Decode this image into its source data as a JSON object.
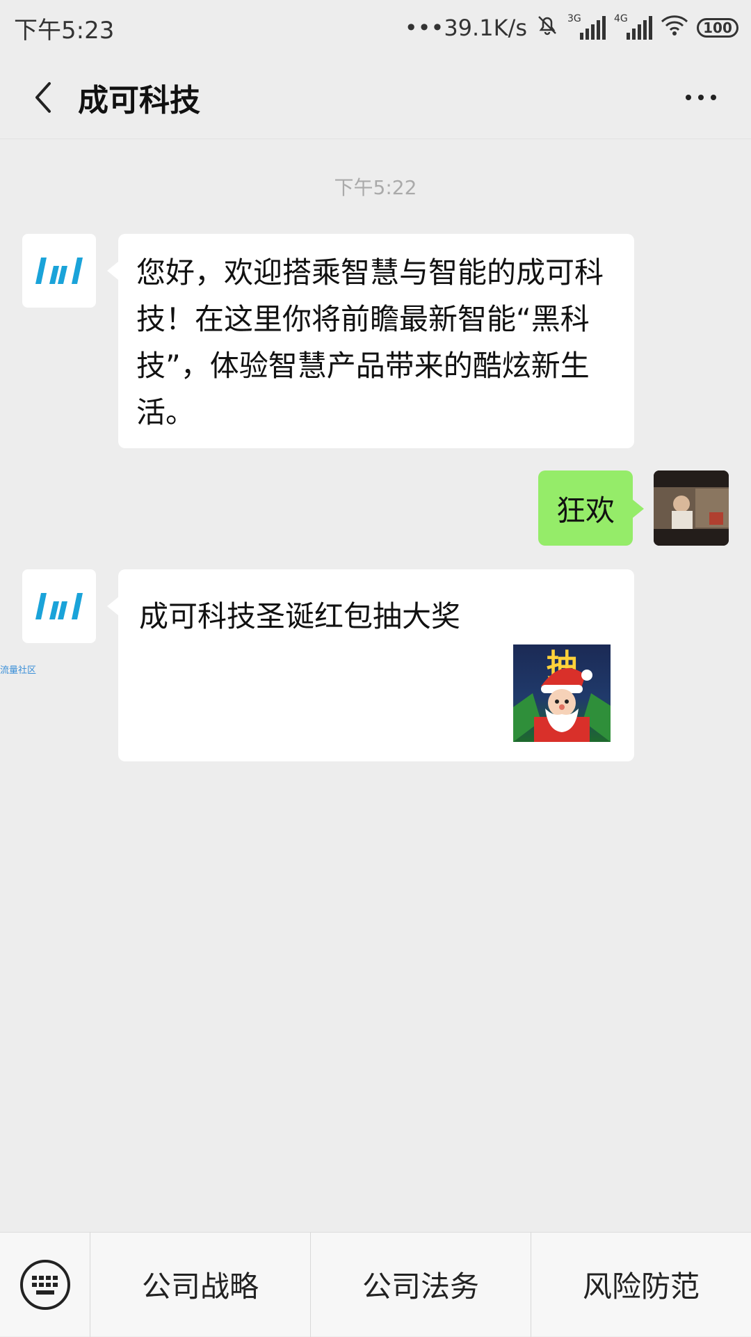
{
  "status_bar": {
    "time": "下午5:23",
    "net_speed": "•••39.1K/s",
    "sim1_label": "3G",
    "sim2_label": "4G",
    "battery": "100"
  },
  "header": {
    "title": "成可科技"
  },
  "chat": {
    "timestamp": "下午5:22",
    "messages": [
      {
        "sender": "company",
        "text": "您好，欢迎搭乘智慧与智能的成可科技！在这里你将前瞻最新智能“黑科技”，体验智慧产品带来的酷炫新生活。"
      },
      {
        "sender": "me",
        "text": "狂欢"
      },
      {
        "sender": "company",
        "type": "link-card",
        "title": "成可科技圣诞红包抽大奖",
        "thumb_text": "抽"
      }
    ],
    "watermark": "流量社区"
  },
  "bottom_menu": {
    "items": [
      "公司战略",
      "公司法务",
      "风险防范"
    ]
  },
  "colors": {
    "background": "#ededed",
    "outgoing_bubble": "#95ec69",
    "logo_blue": "#1aa3d9"
  }
}
